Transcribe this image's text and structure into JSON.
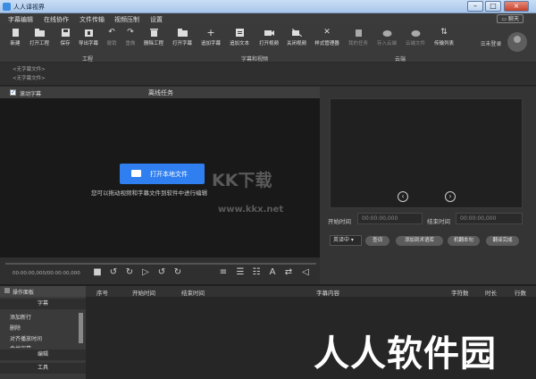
{
  "window": {
    "title": "人人译视界"
  },
  "menu": {
    "items": [
      "字幕编辑",
      "在线协作",
      "文件传输",
      "视频压制",
      "设置"
    ],
    "feedback": "聊天"
  },
  "toolbar": {
    "buttons": [
      "新建",
      "打开工程",
      "保存",
      "导出字幕",
      "撤销",
      "重做",
      "删除工程",
      "打开字幕",
      "追加字幕",
      "追加文本",
      "打开视频",
      "关闭视频",
      "样式管理器",
      "我的任务",
      "存入云端",
      "云端文件",
      "传输列表"
    ],
    "groups": [
      "工程",
      "字幕和视频",
      "云端"
    ],
    "login_label": "未登录"
  },
  "subtitles_area": {
    "line1": "<无字幕文件>",
    "line2": "<无字幕文件>"
  },
  "left_header": {
    "scroll_label": "滚动字幕",
    "task_title": "离线任务"
  },
  "video": {
    "open_button": "打开本地文件",
    "hint": "您可以拖动视频和字幕文件到软件中进行编辑"
  },
  "watermarks": {
    "brand": "KK下载",
    "url": "www.kkx.net",
    "big": "人人软件园"
  },
  "controls": {
    "timecode": "00:00:00,000/00:00:00,000"
  },
  "right_panel": {
    "start_label": "开始时间",
    "start_value": "00:00:00,000",
    "end_label": "结束时间",
    "end_value": "00:00:00,000",
    "lang_select": "英译中",
    "pills": [
      "查词",
      "添加到术语库",
      "机翻本句",
      "翻译完成"
    ]
  },
  "operation_panel": {
    "title": "操作面板",
    "section_subtitle": "字幕",
    "items": [
      "添加新行",
      "删除",
      "对齐播放时间",
      "合并字幕"
    ],
    "section_edit": "编辑",
    "section_tools": "工具"
  },
  "table": {
    "headers": [
      "序号",
      "开始时间",
      "结束时间",
      "字幕内容",
      "字符数",
      "时长",
      "行数"
    ]
  }
}
